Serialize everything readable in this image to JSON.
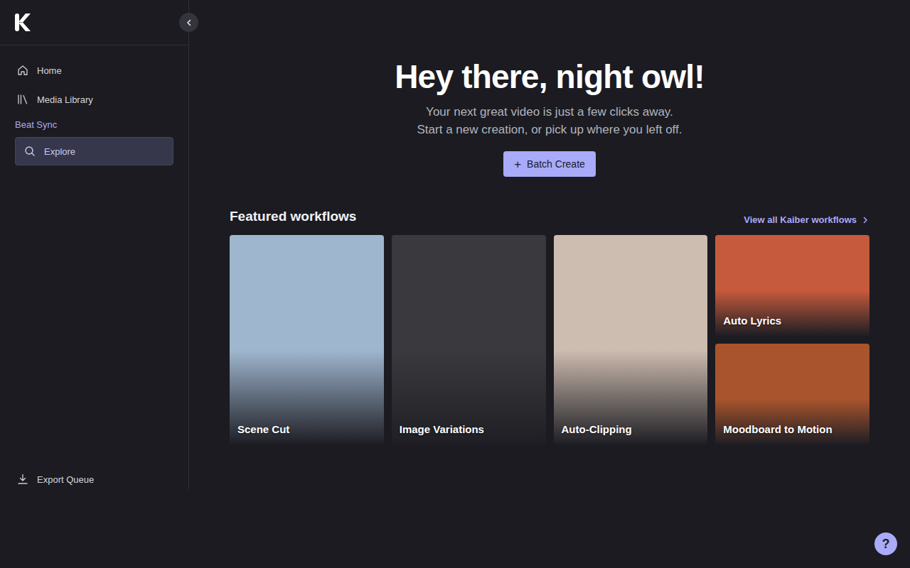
{
  "sidebar": {
    "nav": [
      {
        "label": "Home",
        "selected": false
      },
      {
        "label": "Media Library",
        "selected": false
      }
    ],
    "section": {
      "title": "Beat Sync",
      "items": [
        {
          "label": "Explore",
          "selected": true
        }
      ]
    },
    "footer": {
      "label": "Export Queue"
    }
  },
  "hero": {
    "title": "Hey there, night owl!",
    "subtitle": [
      "Your next great video is just a few clicks away.",
      "Start a new creation, or pick up where you left off."
    ],
    "button": {
      "icon": "+",
      "label": "Batch Create"
    }
  },
  "workflows": {
    "title": "Featured workflows",
    "link": "View all Kaiber workflows",
    "cards": [
      {
        "label": "Scene Cut",
        "color": "#9fb6cf"
      },
      {
        "label": "Image Variations",
        "color": "#3a3a3e"
      },
      {
        "label": "Auto-Clipping",
        "color": "#cdbcb0"
      },
      {
        "label": "Auto Lyrics",
        "color": "#c65a3c"
      },
      {
        "label": "Moodboard to Motion",
        "color": "#a9542c"
      }
    ]
  },
  "help": {
    "label": "?"
  }
}
